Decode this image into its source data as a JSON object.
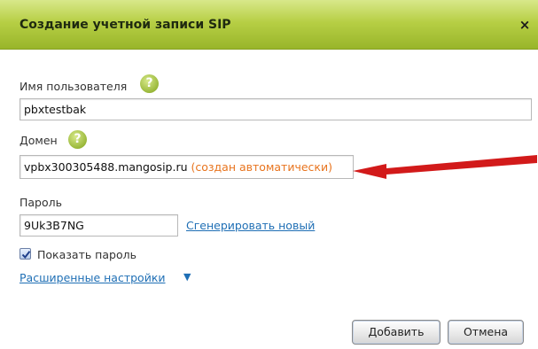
{
  "dialog": {
    "title": "Создание учетной записи SIP",
    "close_icon": "×"
  },
  "form": {
    "username": {
      "label": "Имя пользователя",
      "help_icon": "?",
      "value": "pbxtestbak"
    },
    "domain": {
      "label": "Домен",
      "help_icon": "?",
      "value": "vpbx300305488.mangosip.ru",
      "note": "(создан автоматически)"
    },
    "password": {
      "label": "Пароль",
      "value": "9Uk3B7NG",
      "generate_link": "Сгенерировать новый"
    },
    "show_password": {
      "label": "Показать пароль",
      "checked": true
    },
    "advanced_link": "Расширенные настройки",
    "advanced_icon": "▼"
  },
  "buttons": {
    "add": "Добавить",
    "cancel": "Отмена"
  },
  "colors": {
    "title_bar": "#b7cf45",
    "note": "#e8741e",
    "link": "#1f6fb5",
    "arrow": "#d21a1a"
  }
}
